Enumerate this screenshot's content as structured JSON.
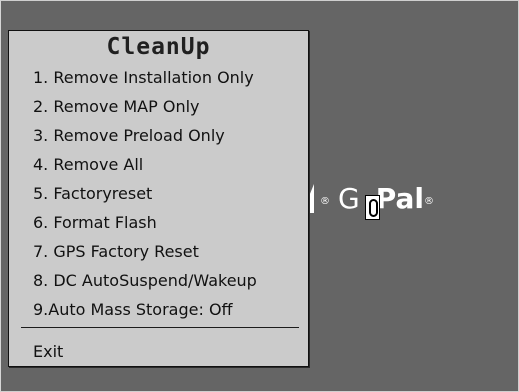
{
  "window": {
    "title": "CleanUp"
  },
  "menu": {
    "items": [
      "1. Remove Installation Only",
      "2. Remove MAP Only",
      "3. Remove Preload Only",
      "4. Remove All",
      "5. Factoryreset",
      "6. Format Flash",
      "7. GPS Factory Reset",
      "8. DC AutoSuspend/Wakeup",
      "9.Auto Mass Storage: Off"
    ],
    "exit_label": "Exit"
  },
  "wallpaper": {
    "brand_go": "G",
    "brand_pal": "Pal",
    "logo_o": "O",
    "registered_mark": "®"
  },
  "colors": {
    "desktop_background": "#656565",
    "menu_background": "#cbcbcb",
    "menu_text": "#111111",
    "logo_text": "#ffffff"
  }
}
